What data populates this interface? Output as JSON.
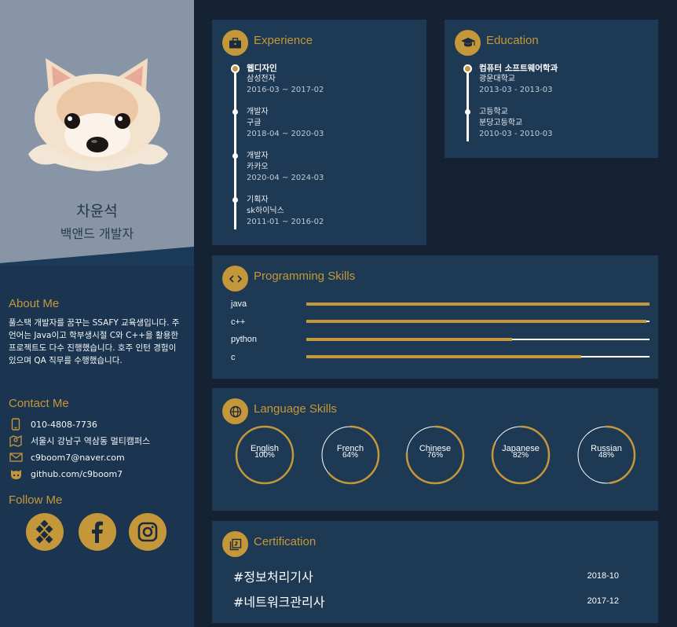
{
  "profile": {
    "name": "차윤석",
    "role": "백앤드 개발자"
  },
  "about": {
    "heading": "About Me",
    "text": "풀스택 개발자를 꿈꾸는 SSAFY 교육생입니다. 주 언어는 Java이고 학부생시절 C와 C++을 활용한 프로젝트도 다수 진행했습니다. 호주 인턴 경험이 있으며 QA 직무를 수행했습니다."
  },
  "contact": {
    "heading": "Contact Me",
    "phone": "010-4808-7736",
    "address": "서울시 강남구 역삼동 멀티캠퍼스",
    "email": "c9boom7@naver.com",
    "github": "github.com/c9boom7"
  },
  "follow": {
    "heading": "Follow Me",
    "links": [
      "blog-icon",
      "facebook-icon",
      "instagram-icon"
    ]
  },
  "experience": {
    "title": "Experience",
    "items": [
      {
        "title": "웹디자인",
        "company": "삼성전자",
        "period": "2016-03 ~ 2017-02"
      },
      {
        "title": "개발자",
        "company": "구글",
        "period": "2018-04 ~ 2020-03"
      },
      {
        "title": "개발자",
        "company": "카카오",
        "period": "2020-04 ~ 2024-03"
      },
      {
        "title": "기획자",
        "company": "sk하이닉스",
        "period": "2011-01 ~ 2016-02"
      }
    ]
  },
  "education": {
    "title": "Education",
    "items": [
      {
        "title": "컴퓨터 소프트웨어학과",
        "school": "광운대학교",
        "period": "2013-03 - 2013-03"
      },
      {
        "title": "고등학교",
        "school": "분당고등학교",
        "period": "2010-03 - 2010-03"
      }
    ]
  },
  "programming": {
    "title": "Programming Skills",
    "skills": [
      {
        "name": "java",
        "level": 1.0
      },
      {
        "name": "c++",
        "level": 0.99
      },
      {
        "name": "python",
        "level": 0.6
      },
      {
        "name": "c",
        "level": 0.8
      }
    ]
  },
  "languages": {
    "title": "Language Skills",
    "items": [
      {
        "name": "English",
        "percent": "100%",
        "level": 1.0
      },
      {
        "name": "French",
        "percent": "64%",
        "level": 0.64
      },
      {
        "name": "Chinese",
        "percent": "76%",
        "level": 0.76
      },
      {
        "name": "Japanese",
        "percent": "82%",
        "level": 0.82
      },
      {
        "name": "Russian",
        "percent": "48%",
        "level": 0.48
      }
    ]
  },
  "certification": {
    "title": "Certification",
    "items": [
      {
        "name": "#정보처리기사",
        "date": "2018-10"
      },
      {
        "name": "#네트워크관리사",
        "date": "2017-12"
      }
    ]
  },
  "colors": {
    "accent": "#c4983a",
    "card": "#1e3954",
    "sidebar": "#1b3550",
    "profile_bg": "#8795a6"
  }
}
